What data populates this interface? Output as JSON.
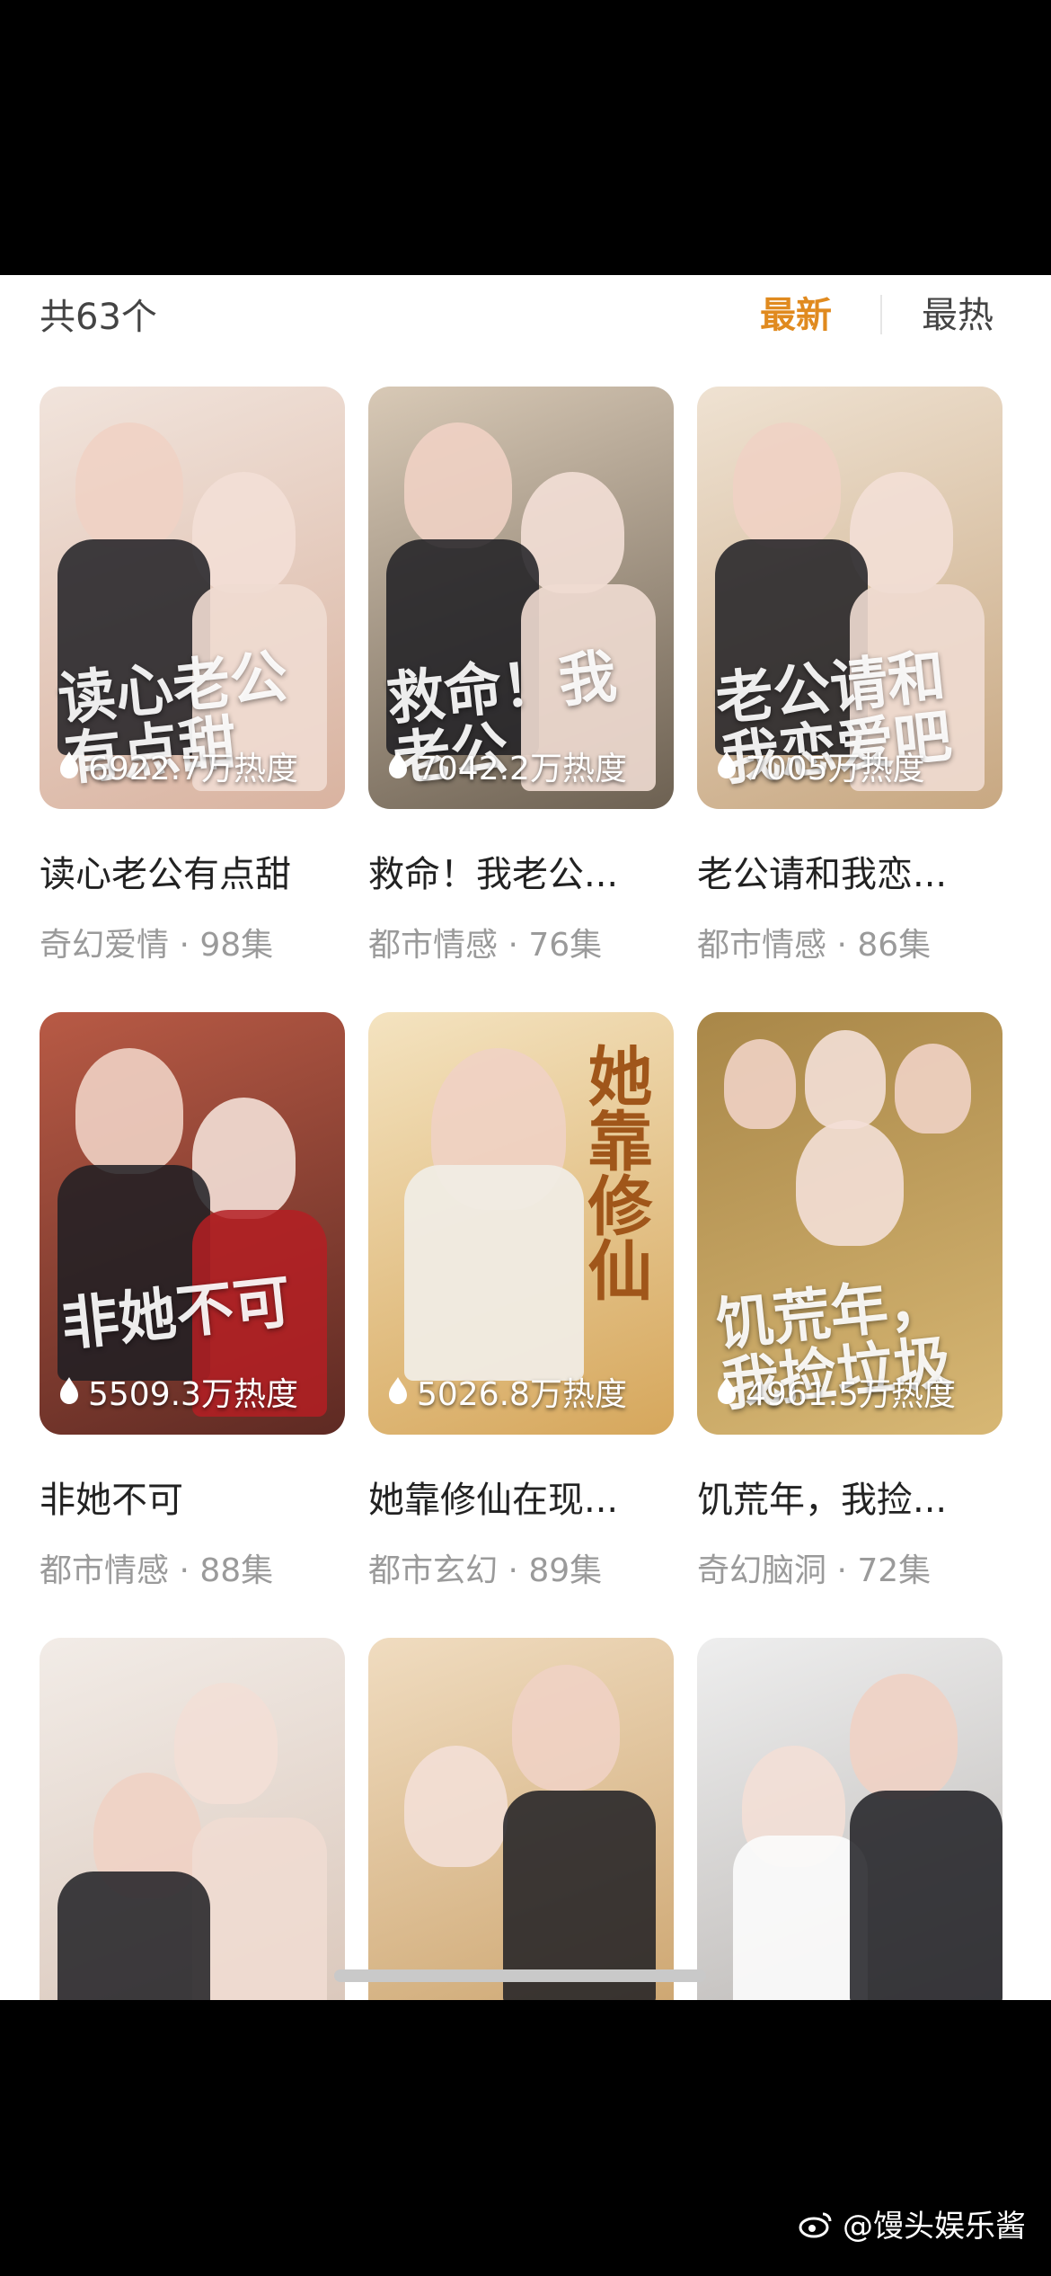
{
  "header": {
    "count_label": "共63个",
    "sort_newest": "最新",
    "sort_hottest": "最热"
  },
  "colors": {
    "accent": "#e08a1f",
    "meta_text": "#9a9a9a",
    "title_text": "#222222"
  },
  "cards": [
    {
      "title": "读心老公有点甜",
      "meta": "奇幻爱情 · 98集",
      "heat": "6922.7万热度",
      "poster_text": "读心老公有点甜",
      "bg": [
        "#d9b3a0",
        "#f1e4dc"
      ],
      "icon": "flame-icon"
    },
    {
      "title": "救命！我老公...",
      "meta": "都市情感 · 76集",
      "heat": "7042.2万热度",
      "poster_text": "救命！我老公",
      "bg": [
        "#6d6152",
        "#d8c9b6"
      ],
      "icon": "flame-icon"
    },
    {
      "title": "老公请和我恋...",
      "meta": "都市情感 · 86集",
      "heat": "7005万热度",
      "poster_text": "老公请和我恋爱吧",
      "bg": [
        "#c8a882",
        "#efe2d2"
      ],
      "icon": "flame-icon"
    },
    {
      "title": "非她不可",
      "meta": "都市情感 · 88集",
      "heat": "5509.3万热度",
      "poster_text": "非她不可",
      "bg": [
        "#5e2a23",
        "#b85a45"
      ],
      "icon": "flame-icon"
    },
    {
      "title": "她靠修仙在现...",
      "meta": "都市玄幻 · 89集",
      "heat": "5026.8万热度",
      "poster_text": "她靠修仙",
      "bg": [
        "#d6a75c",
        "#f4e3c0"
      ],
      "icon": "flame-icon"
    },
    {
      "title": "饥荒年，我捡...",
      "meta": "奇幻脑洞 · 72集",
      "heat": "4961.5万热度",
      "poster_text": "饥荒年，我捡垃圾",
      "bg": [
        "#d7b774",
        "#a98748"
      ],
      "icon": "flame-icon"
    },
    {
      "title": "",
      "meta": "",
      "heat": "",
      "poster_text": "",
      "bg": [
        "#d8c4b7",
        "#f2ece7"
      ],
      "icon": ""
    },
    {
      "title": "",
      "meta": "",
      "heat": "",
      "poster_text": "",
      "bg": [
        "#caa169",
        "#f0dcc0"
      ],
      "icon": ""
    },
    {
      "title": "",
      "meta": "",
      "heat": "",
      "poster_text": "",
      "bg": [
        "#b7b3b0",
        "#eeeeee"
      ],
      "icon": ""
    }
  ],
  "watermark": {
    "text": "@馒头娱乐酱",
    "icon": "weibo-icon"
  }
}
